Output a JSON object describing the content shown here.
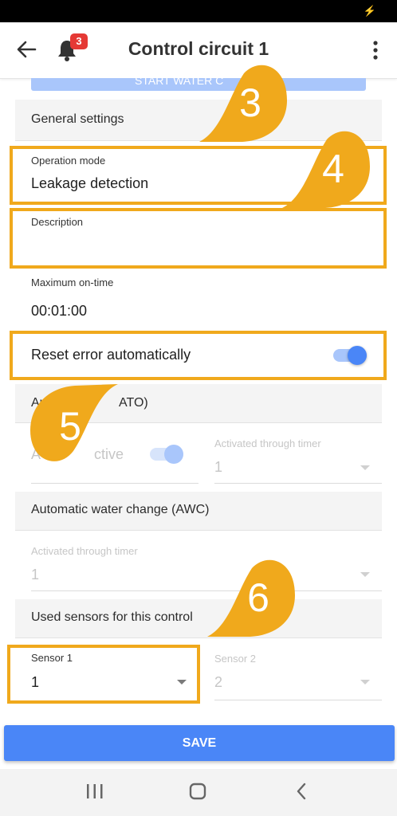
{
  "status_bar": {
    "charging_icon": "bolt-icon"
  },
  "app_bar": {
    "title": "Control circuit 1",
    "notification_count": "3",
    "back_icon": "arrow-left-icon",
    "bell_icon": "bell-icon",
    "menu_icon": "more-vert-icon"
  },
  "top_button_partial": "START WATER C",
  "general_settings": {
    "header": "General settings",
    "operation_mode": {
      "label": "Operation mode",
      "value": "Leakage detection"
    },
    "description": {
      "label": "Description",
      "value": ""
    },
    "max_on_time": {
      "label": "Maximum on-time",
      "value": "00:01:00"
    },
    "reset_error": {
      "label": "Reset error automatically",
      "on": true
    }
  },
  "ato": {
    "header_left": "Au",
    "header_right": "ATO)",
    "active_label_left": "A",
    "active_label_right": "ctive",
    "active_on": true,
    "timer": {
      "label": "Activated through timer",
      "value": "1"
    }
  },
  "awc": {
    "header": "Automatic water change (AWC)",
    "timer": {
      "label": "Activated through timer",
      "value": "1"
    }
  },
  "sensors": {
    "header": "Used sensors for this control",
    "sensor1": {
      "label": "Sensor 1",
      "value": "1"
    },
    "sensor2": {
      "label": "Sensor 2",
      "value": "2"
    }
  },
  "save_label": "SAVE",
  "callouts": [
    "3",
    "4",
    "5",
    "6"
  ],
  "colors": {
    "accent": "#4a86f7",
    "highlight": "#f0a91c",
    "badge": "#e53935"
  },
  "nav_bar": {
    "recents_icon": "recents-icon",
    "home_icon": "home-icon",
    "back_icon": "back-triangle-icon"
  }
}
